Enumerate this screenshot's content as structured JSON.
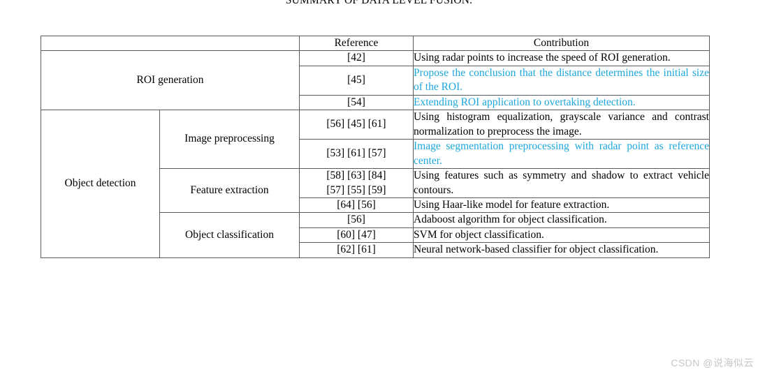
{
  "caption": {
    "text": "SUMMARY OF DATA LEVEL FUSION."
  },
  "colors": {
    "highlight": "#1ca7dd",
    "text": "#000000",
    "border": "#555c5f",
    "watermark": "#c7c7c7"
  },
  "table": {
    "headers": {
      "category": "",
      "subcategory": "",
      "reference": "Reference",
      "contribution": "Contribution"
    },
    "sections": [
      {
        "category": "ROI generation",
        "rows": [
          {
            "subcategory": "",
            "reference": "[42]",
            "contribution": "Using radar points to increase the speed of ROI generation.",
            "highlight": false
          },
          {
            "subcategory": "",
            "reference": "[45]",
            "contribution": "Propose the conclusion that the distance deter­mines the initial size of the ROI.",
            "highlight": true
          },
          {
            "subcategory": "",
            "reference": "[54]",
            "contribution": "Extending ROI application to overtaking detec­tion.",
            "highlight": true
          }
        ]
      },
      {
        "category": "Object detection",
        "subgroups": [
          {
            "subcategory": "Image preprocessing",
            "rows": [
              {
                "reference": "[56] [45] [61]",
                "contribution": "Using histogram equalization, grayscale variance and contrast normalization to preprocess the im­age.",
                "highlight": false
              },
              {
                "reference": "[53] [61] [57]",
                "contribution": "Image segmentation preprocessing with radar point as reference center.",
                "highlight": true
              }
            ]
          },
          {
            "subcategory": "Feature extraction",
            "rows": [
              {
                "reference": "[58] [63] [84] [57] [55] [59]",
                "reference_line1": "[58] [63] [84]",
                "reference_line2": "[57] [55] [59]",
                "contribution": "Using features such as symmetry and shadow to extract vehicle contours.",
                "highlight": false
              },
              {
                "reference": "[64] [56]",
                "contribution": "Using Haar-like model for feature extraction.",
                "highlight": false
              }
            ]
          },
          {
            "subcategory": "Object classification",
            "rows": [
              {
                "reference": "[56]",
                "contribution": "Adaboost algorithm for object classification.",
                "highlight": false
              },
              {
                "reference": "[60] [47]",
                "contribution": "SVM for object classification.",
                "highlight": false
              },
              {
                "reference": "[62] [61]",
                "contribution": "Neural network-based classifier for object classi­fication.",
                "highlight": false
              }
            ]
          }
        ]
      }
    ]
  },
  "watermark": {
    "text": "CSDN @说海似云"
  }
}
